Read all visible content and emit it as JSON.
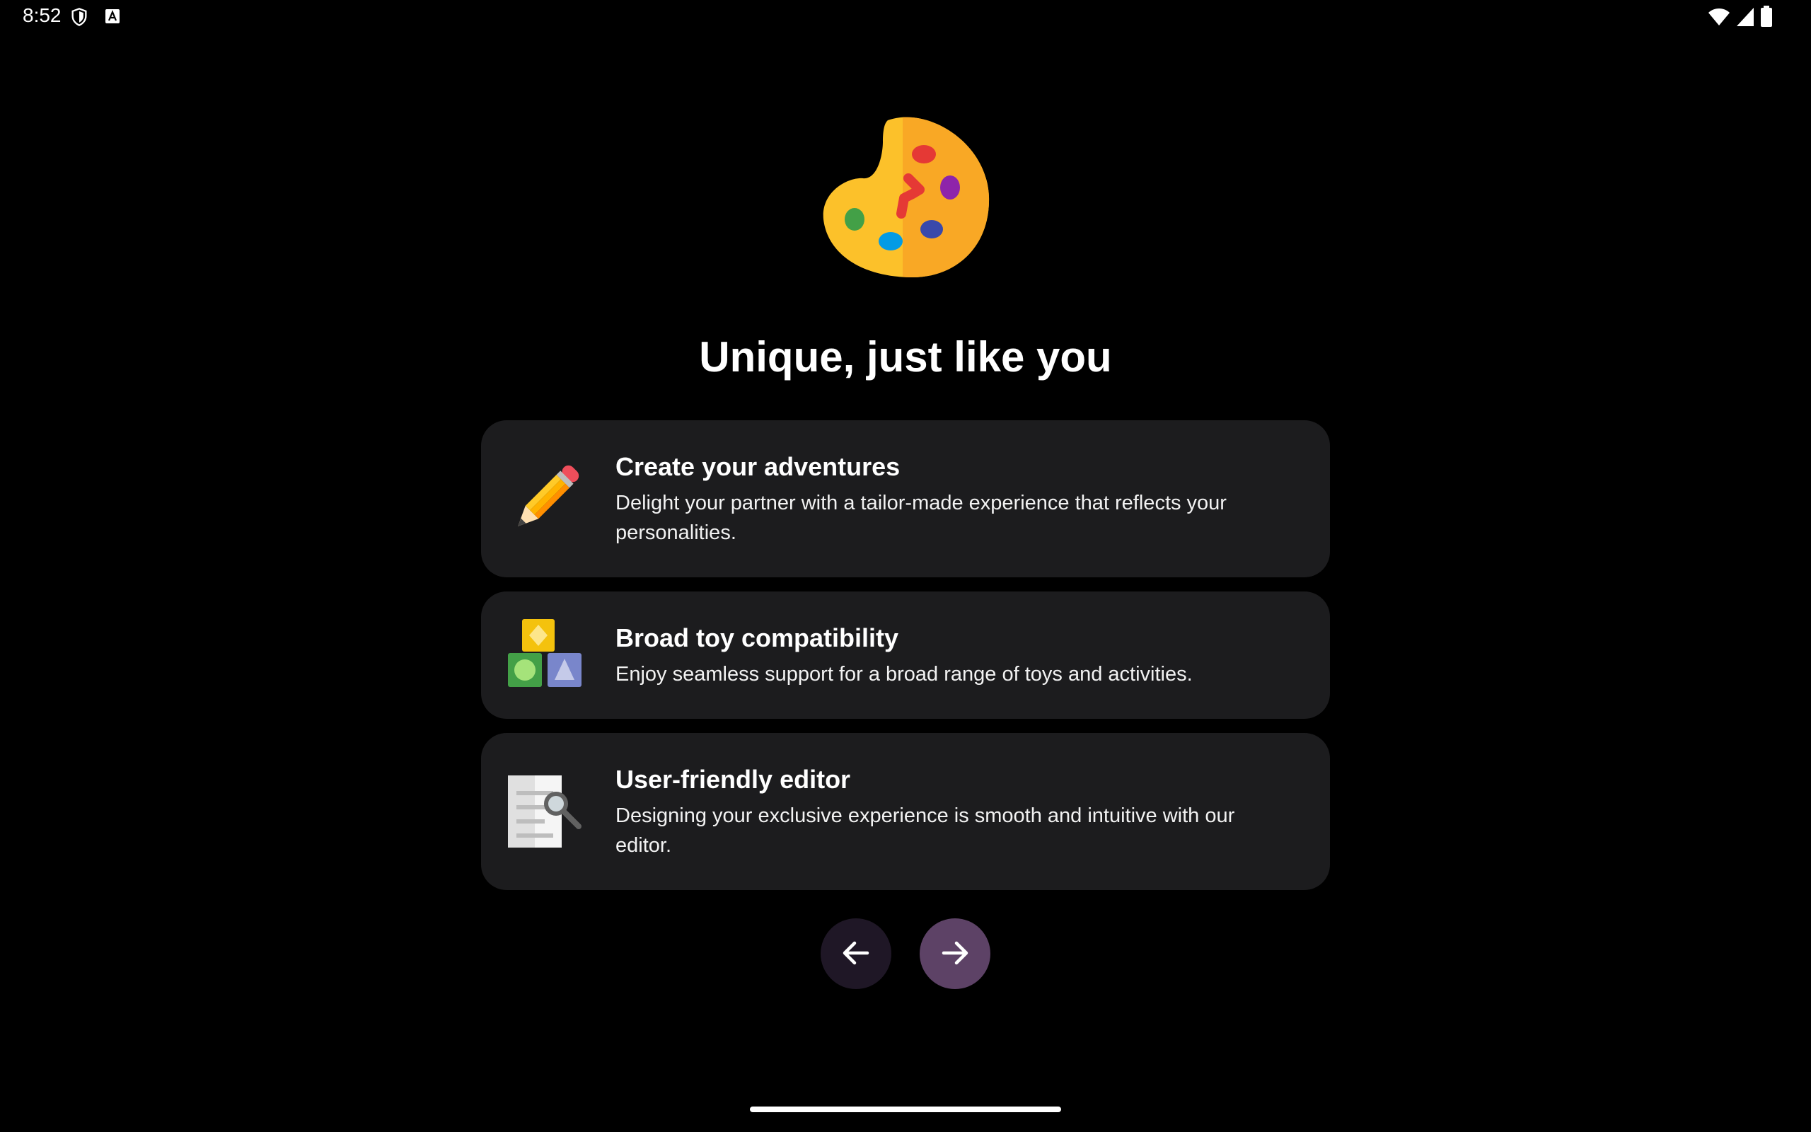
{
  "status_bar": {
    "time": "8:52",
    "left_icons": [
      "shield-icon",
      "keyboard-a-icon"
    ],
    "right_icons": [
      "wifi-icon",
      "cellular-signal-icon",
      "battery-icon"
    ]
  },
  "hero": {
    "icon": "paint-palette-icon",
    "title": "Unique, just like you"
  },
  "features": [
    {
      "icon": "pencil-icon",
      "title": "Create your adventures",
      "description": "Delight your partner with a tailor-made experience that reflects your personalities."
    },
    {
      "icon": "toy-blocks-icon",
      "title": "Broad toy compatibility",
      "description": "Enjoy seamless support for a broad range of toys and activities."
    },
    {
      "icon": "document-search-icon",
      "title": "User-friendly editor",
      "description": "Designing your exclusive experience is smooth and intuitive with our editor."
    }
  ],
  "navigation": {
    "back_icon": "arrow-left-icon",
    "next_icon": "arrow-right-icon"
  },
  "colors": {
    "background": "#000000",
    "card": "#1c1c1e",
    "back_button": "#1f1726",
    "next_button": "#5d4266"
  }
}
